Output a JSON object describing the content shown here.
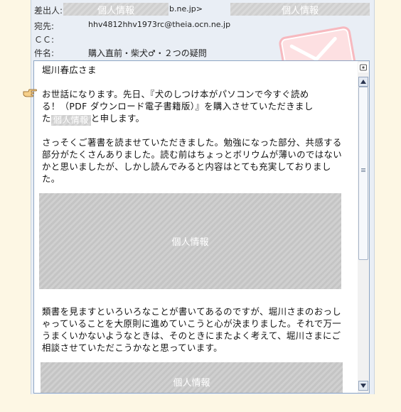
{
  "header": {
    "from_label": "差出人:",
    "from_tail": "b.ne.jp>",
    "to_label": "宛先:",
    "to_value": "hhv4812hhv1973rc@theia.ocn.ne.jp",
    "cc_label": "ＣＣ:",
    "subject_label": "件名:",
    "subject_value": "購入直前・柴犬♂・２つの疑問"
  },
  "redaction_label": "個人情報",
  "body": {
    "greeting": "堀川春広さま",
    "p1_line1": "お世話になります。先日、『犬のしつけ本がパソコンで今すぐ読め",
    "p1_line2": "る！（PDF ダウンロード電子書籍版）』を購入させていただきまし",
    "p1_line3_pre": "た",
    "p1_line3_post": "と申します。",
    "p2": "さっそくご著書を読ませていただきました。勉強になった部分、共感する部分がたくさんありました。読む前はちょっとボリウムが薄いのではないかと思いましたが、しかし読んでみると内容はとても充実しておりました。",
    "p3": "類書を見ますといろいろなことが書いてあるのですが、堀川さまのおっしゃっていることを大原則に進めていこうと心が決まりました。それで万一うまくいかないようなときは、そのときにまたよく考えて、堀川さまにご相談させていただこうかなと思っています。"
  },
  "colors": {
    "page_bg": "#fdf7e4",
    "panel_bg": "#e9eef5",
    "envelope": "#f7b9bf"
  }
}
